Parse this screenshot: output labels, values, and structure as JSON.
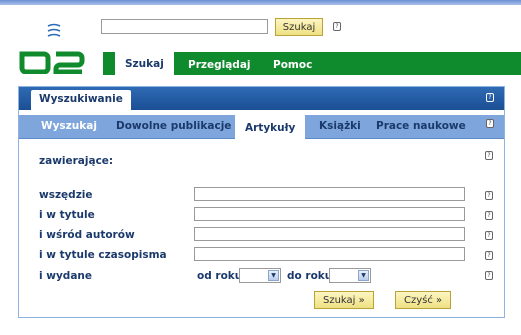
{
  "search": {
    "value": "",
    "button_label": "Szukaj",
    "help": "?"
  },
  "main_nav": {
    "tabs": [
      {
        "label": "Szukaj"
      },
      {
        "label": "Przeglądaj"
      },
      {
        "label": "Pomoc"
      }
    ]
  },
  "panel": {
    "title": "Wyszukiwanie",
    "help": "?",
    "tabs": [
      {
        "label": "Wyszukaj"
      },
      {
        "label": "Dowolne publikacje"
      },
      {
        "label": "Artykuły"
      },
      {
        "label": "Książki"
      },
      {
        "label": "Prace naukowe"
      }
    ],
    "subtitle": "zawierające:",
    "fields": [
      {
        "label": "wszędzie",
        "value": ""
      },
      {
        "label": "i w tytule",
        "value": ""
      },
      {
        "label": "i wśród autorów",
        "value": ""
      },
      {
        "label": "i w tytule czasopisma",
        "value": ""
      }
    ],
    "published": {
      "label": "i wydane",
      "from_label": "od roku",
      "to_label": "do roku",
      "from_value": "",
      "to_value": ""
    },
    "search_button": "Szukaj »",
    "clear_button": "Czyść »"
  },
  "colors": {
    "green_nav": "#0f8a2c",
    "panel_head": "#1b4f95",
    "sub_nav": "#7ea6dc",
    "label_text": "#1b3a6b",
    "button": "#efe082"
  }
}
